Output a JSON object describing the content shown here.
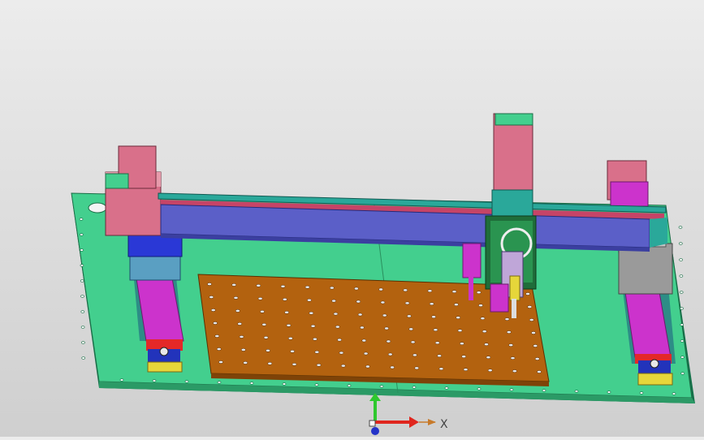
{
  "viewport": {
    "background_top": "#ececec",
    "background_bottom": "#cfcfcf"
  },
  "model_colors": {
    "base_plate": "#43cf8e",
    "work_table": "#b3620f",
    "gantry_beam": "#5b5fc8",
    "linear_rail": "#2aa89a",
    "motor_block": "#d9708a",
    "slide_carriage": "#cc33cc",
    "x_axis_arrow": "#e0261e",
    "y_axis_arrow": "#2ec82e",
    "z_axis_marker": "#2433c8"
  },
  "triad": {
    "x_label": "X",
    "x_icon": "x-axis-arrow-icon",
    "y_icon": "y-axis-arrow-icon",
    "z_icon": "z-axis-origin-icon"
  }
}
